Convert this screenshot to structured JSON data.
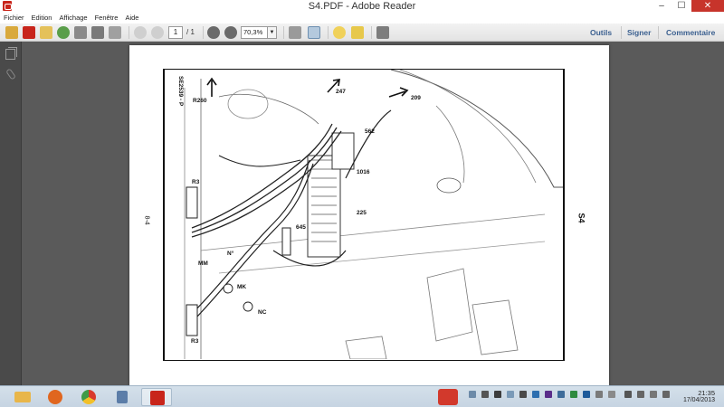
{
  "window": {
    "title": "S4.PDF - Adobe Reader",
    "controls": {
      "minimize": "–",
      "maximize": "☐",
      "close": "✕"
    }
  },
  "menu": {
    "items": [
      "Fichier",
      "Edition",
      "Affichage",
      "Fenêtre",
      "Aide"
    ]
  },
  "toolbar": {
    "page_current": "1",
    "page_total": "/ 1",
    "zoom": "70,3%",
    "right_buttons": [
      "Outils",
      "Signer",
      "Commentaire"
    ],
    "accent_color": "#3a5f8f"
  },
  "document": {
    "page_side_left": "8-4",
    "page_side_right": "S4",
    "ref_code": "SE2539 - P",
    "labels": {
      "r260": "R260",
      "n247": "247",
      "n209": "209",
      "n562": "562",
      "n1016": "1016",
      "n225": "225",
      "n645": "645",
      "r3_top": "R3",
      "r3_bottom": "R3",
      "n_deg": "N°",
      "mm": "MM",
      "mk": "MK",
      "nc": "NC"
    }
  },
  "taskbar": {
    "apps": [
      {
        "name": "file-explorer",
        "color": "#e8b64a"
      },
      {
        "name": "firefox",
        "color": "#e0661f"
      },
      {
        "name": "chrome",
        "color": "#3f9b48"
      },
      {
        "name": "java",
        "color": "#5b7da8"
      },
      {
        "name": "adobe-reader",
        "color": "#c8251b"
      }
    ],
    "clock_time": "21:35",
    "clock_date": "17/04/2013"
  }
}
